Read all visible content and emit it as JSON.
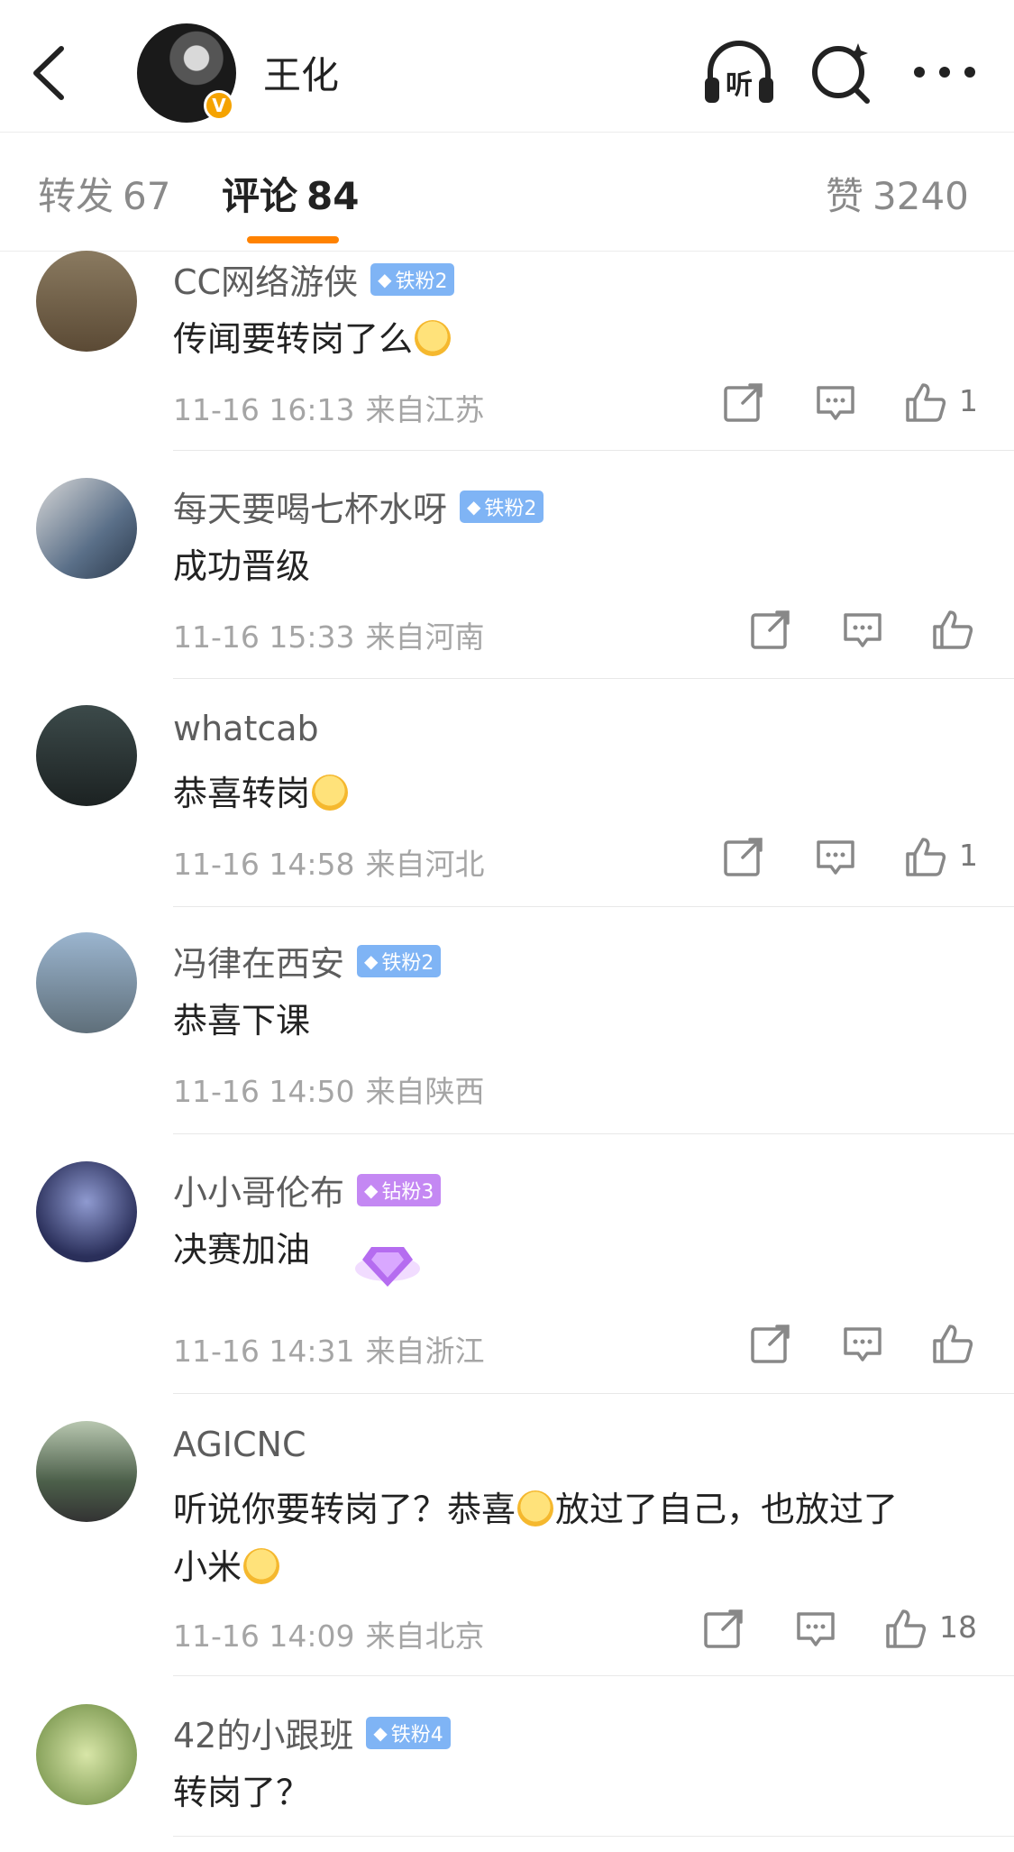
{
  "header": {
    "username": "王化",
    "verified_badge": "V",
    "icons": [
      "back-icon",
      "listen-icon",
      "search-icon",
      "more-icon"
    ],
    "listen_label": "听"
  },
  "tabs": [
    {
      "label": "转发",
      "count": "67"
    },
    {
      "label": "评论",
      "count": "84"
    },
    {
      "label": "赞",
      "count": "3240"
    }
  ],
  "comments": [
    {
      "name": "CC网络游侠",
      "badge": "铁粉2",
      "badge_color": "#7fb4f5",
      "text": "传闻要转岗了么",
      "emoji": true,
      "time": "11-16 16:13",
      "location": "来自江苏",
      "likes": "1"
    },
    {
      "name": "每天要喝七杯水呀",
      "badge": "铁粉2",
      "badge_color": "#7fb4f5",
      "text": "成功晋级",
      "emoji": false,
      "time": "11-16 15:33",
      "location": "来自河南",
      "likes": ""
    },
    {
      "name": "whatcab",
      "badge": "",
      "badge_color": "",
      "text": "恭喜转岗",
      "emoji": true,
      "time": "11-16 14:58",
      "location": "来自河北",
      "likes": "1"
    },
    {
      "name": "冯律在西安",
      "badge": "铁粉2",
      "badge_color": "#7fb4f5",
      "text": "恭喜下课",
      "emoji": false,
      "time": "11-16 14:50",
      "location": "来自陕西",
      "likes": ""
    },
    {
      "name": "小小哥伦布",
      "badge": "钻粉3",
      "badge_color": "#c488f3",
      "text": "决赛加油",
      "emoji": false,
      "time": "11-16 14:31",
      "location": "来自浙江",
      "likes": ""
    },
    {
      "name": "AGICNC",
      "badge": "",
      "badge_color": "",
      "text_line1_a": "听说你要转岗了？恭喜",
      "text_line1_b": "放过了自己，也放过了",
      "text_line2": "小米",
      "time": "11-16 14:09",
      "location": "来自北京",
      "likes": "18"
    },
    {
      "name": "42的小跟班",
      "badge": "铁粉4",
      "badge_color": "#7fb4f5",
      "text": "转岗了？",
      "emoji": false
    }
  ],
  "colors": {
    "accent": "#ff8200",
    "badge_blue": "#7fb4f5",
    "badge_purple": "#c488f3",
    "verified": "#f5a300"
  }
}
